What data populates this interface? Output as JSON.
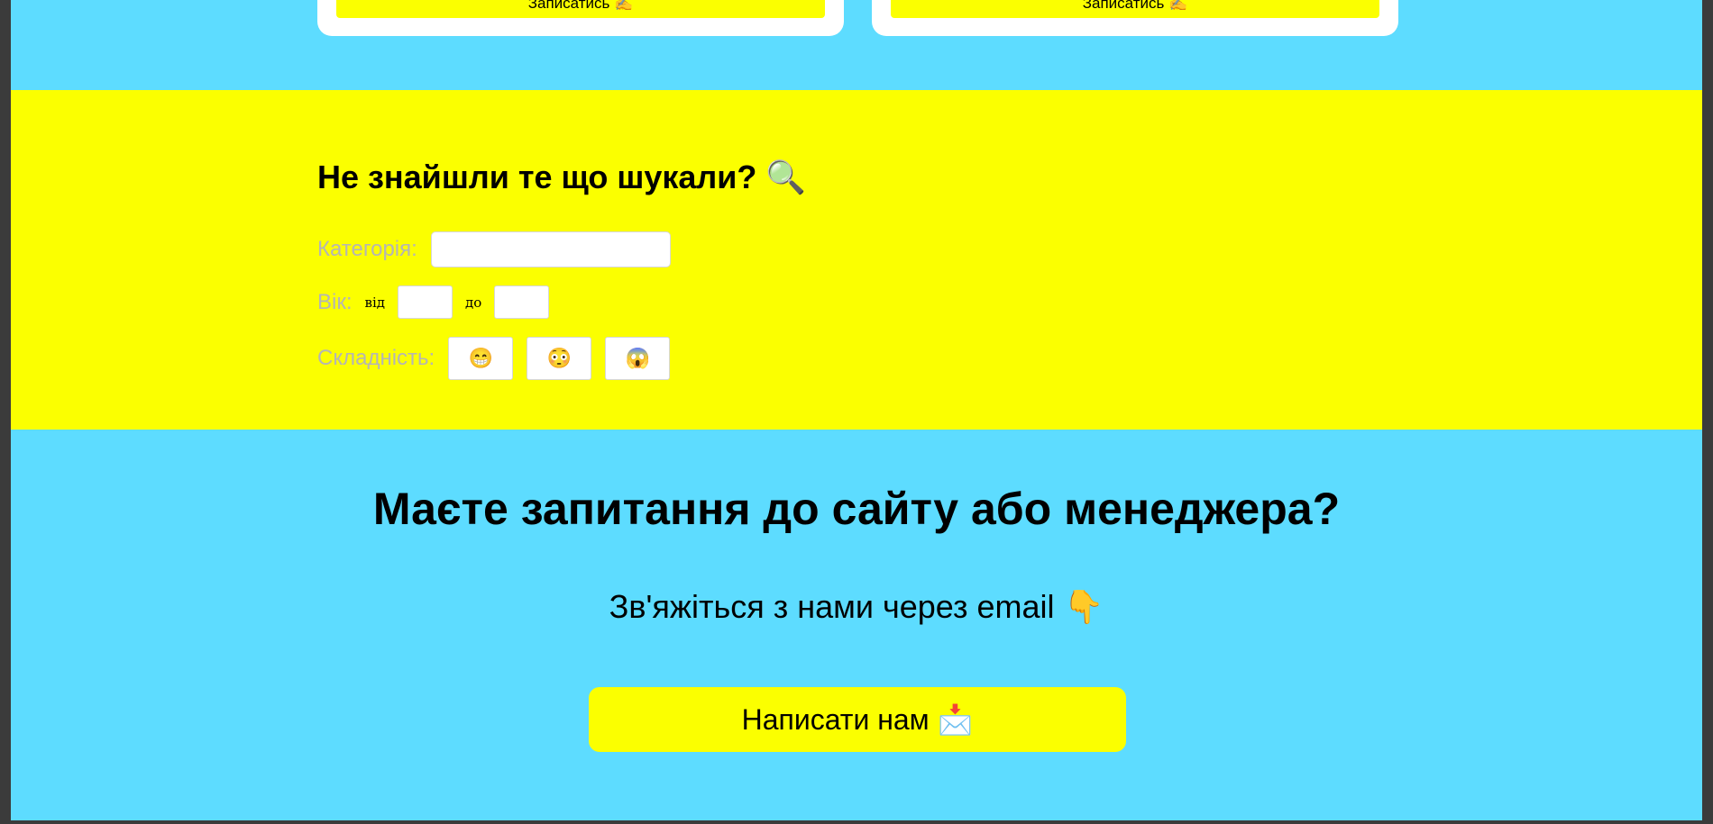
{
  "colors": {
    "cyan_band": "#5ddcff",
    "yellow_band": "#fbff00",
    "card_white": "#ffffff",
    "muted_label": "#b5b5b5"
  },
  "cards": [
    {
      "button_label": "Записатись ✍️"
    },
    {
      "button_label": "Записатись ✍️"
    }
  ],
  "search": {
    "title": "Не знайшли те що шукали? 🔍",
    "category_label": "Категорія:",
    "category_value": "",
    "age_label": "Вік:",
    "age_from_label": "від",
    "age_from_value": "",
    "age_to_label": "до",
    "age_to_value": "",
    "difficulty_label": "Складність:",
    "difficulty_options": [
      {
        "icon": "😁",
        "icon_name": "grinning-face-icon"
      },
      {
        "icon": "😳",
        "icon_name": "flushed-face-icon"
      },
      {
        "icon": "😱",
        "icon_name": "screaming-face-icon"
      }
    ]
  },
  "contact": {
    "title": "Маєте запитання до сайту або менеджера?",
    "subtitle": "Зв'яжіться з нами через email 👇",
    "button_label": "Написати нам 📩"
  }
}
